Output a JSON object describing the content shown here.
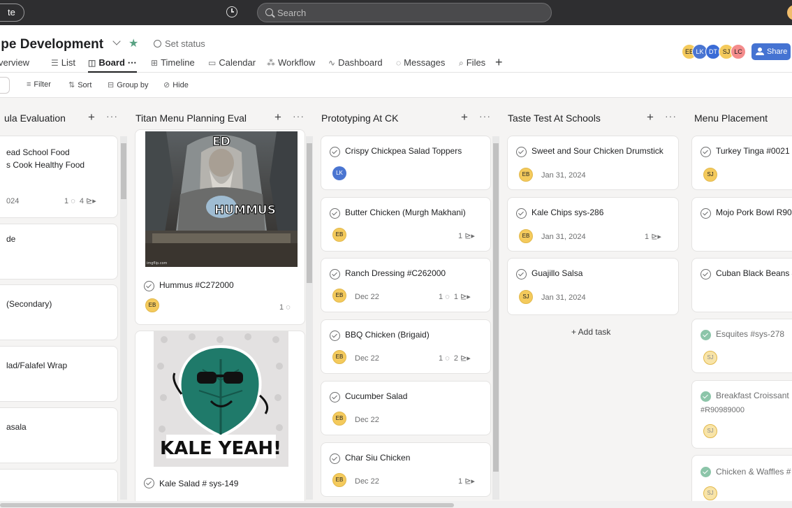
{
  "topbar": {
    "create_label": "te",
    "search_placeholder": "Search"
  },
  "header": {
    "project_title": "ipe Development",
    "set_status": "Set status",
    "share_label": "Share",
    "tabs": [
      {
        "label": "verview",
        "icon": ""
      },
      {
        "label": "List",
        "icon": "list-icon"
      },
      {
        "label": "Board",
        "icon": "board-icon",
        "active": true,
        "more": "⋯"
      },
      {
        "label": "Timeline",
        "icon": "timeline-icon"
      },
      {
        "label": "Calendar",
        "icon": "calendar-icon"
      },
      {
        "label": "Workflow",
        "icon": "workflow-icon"
      },
      {
        "label": "Dashboard",
        "icon": "dashboard-icon"
      },
      {
        "label": "Messages",
        "icon": "messages-icon"
      },
      {
        "label": "Files",
        "icon": "files-icon"
      }
    ],
    "members": [
      {
        "initials": "EB",
        "color": "#f4ca5c"
      },
      {
        "initials": "LK",
        "color": "#4a75d1"
      },
      {
        "initials": "DT",
        "color": "#3a6bd6"
      },
      {
        "initials": "SJ",
        "color": "#f4ca5c"
      },
      {
        "initials": "LC",
        "color": "#f48c8c"
      }
    ]
  },
  "toolbar": {
    "filter": "Filter",
    "sort": "Sort",
    "group_by": "Group by",
    "hide": "Hide"
  },
  "columns": [
    {
      "title": "ula Evaluation",
      "cards": [
        {
          "title": "ead School Food\ns Cook Healthy Food",
          "date": "024",
          "comments": "1",
          "subtasks": "4"
        },
        {
          "title": "de"
        },
        {
          "title": "(Secondary)"
        },
        {
          "title": "lad/Falafel Wrap"
        },
        {
          "title": "asala"
        },
        {
          "title": ""
        }
      ]
    },
    {
      "title": "Titan Menu Planning Eval",
      "cards": [
        {
          "title": "Hummus #C272000",
          "assignee": "EB",
          "comments": "1",
          "image_top": "ED",
          "image_bottom": "HUMMUS",
          "image_credit": "imgflip.com"
        },
        {
          "title": "Kale Salad # sys-149",
          "image_text": "KALE YEAH!"
        }
      ]
    },
    {
      "title": "Prototyping At CK",
      "cards": [
        {
          "title": "Crispy Chickpea Salad Toppers",
          "assignee": "LK"
        },
        {
          "title": "Butter Chicken (Murgh Makhani)",
          "assignee": "EB",
          "subtasks": "1"
        },
        {
          "title": "Ranch Dressing #C262000",
          "assignee": "EB",
          "date": "Dec 22",
          "comments": "1",
          "subtasks": "1"
        },
        {
          "title": "BBQ Chicken (Brigaid)",
          "assignee": "EB",
          "date": "Dec 22",
          "comments": "1",
          "subtasks": "2"
        },
        {
          "title": "Cucumber Salad",
          "assignee": "EB",
          "date": "Dec 22"
        },
        {
          "title": "Char Siu Chicken",
          "assignee": "EB",
          "date": "Dec 22",
          "subtasks": "1"
        }
      ]
    },
    {
      "title": "Taste Test At Schools",
      "add_task": "+ Add task",
      "cards": [
        {
          "title": "Sweet and Sour Chicken Drumstick",
          "assignee": "EB",
          "date": "Jan 31, 2024"
        },
        {
          "title": "Kale Chips sys-286",
          "assignee": "EB",
          "date": "Jan 31, 2024",
          "subtasks": "1"
        },
        {
          "title": "Guajillo Salsa",
          "assignee": "SJ",
          "date": "Jan 31, 2024"
        }
      ]
    },
    {
      "title": "Menu Placement",
      "cards": [
        {
          "title": "Turkey Tinga #0021",
          "assignee": "SJ"
        },
        {
          "title": "Mojo Pork Bowl R90"
        },
        {
          "title": "Cuban Black Beans #"
        },
        {
          "title": "Esquites #sys-278",
          "assignee": "SJ",
          "done": true
        },
        {
          "title": "Breakfast Croissant",
          "subtitle": "#R90989000",
          "assignee": "SJ",
          "done": true
        },
        {
          "title": "Chicken & Waffles #",
          "assignee": "SJ",
          "done": true
        }
      ]
    }
  ]
}
